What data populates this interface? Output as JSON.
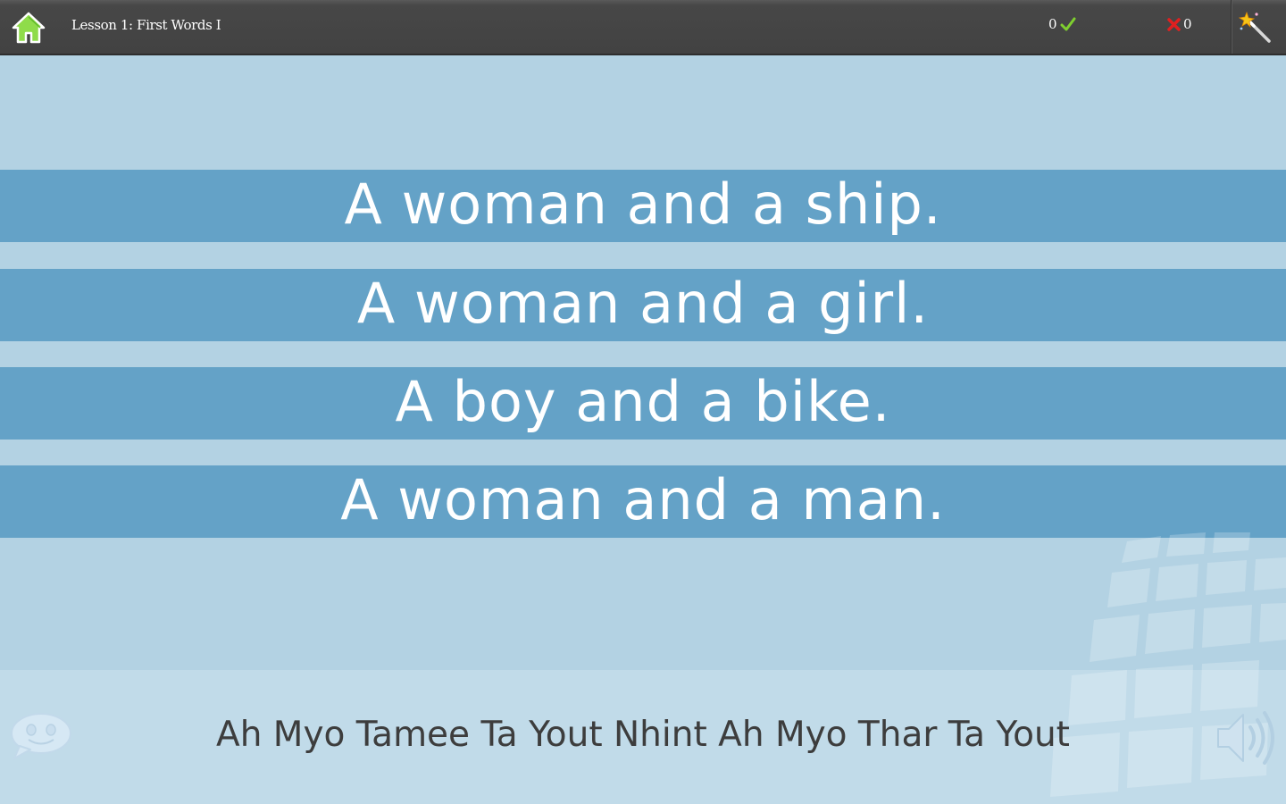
{
  "header": {
    "lesson_title": "Lesson 1: First Words I",
    "correct_count": "0",
    "wrong_count": "0",
    "home_icon": "home-icon",
    "correct_icon": "checkmark-icon",
    "wrong_icon": "cross-icon",
    "wand_icon": "magic-wand-icon"
  },
  "options": [
    {
      "label": "A woman and a ship."
    },
    {
      "label": "A woman and a girl."
    },
    {
      "label": "A boy and a bike."
    },
    {
      "label": "A woman and a man."
    }
  ],
  "prompt": {
    "phrase": "Ah Myo Tamee Ta Yout Nhint Ah Myo Thar Ta Yout",
    "hint_icon": "speech-bubble-face-icon",
    "sound_icon": "speaker-icon"
  },
  "colors": {
    "background": "#b3d2e3",
    "topbar": "#444444",
    "option_band": "#64a2c7",
    "bottom_panel": "#c1dbe9",
    "correct_green": "#7fcf2f",
    "wrong_red": "#e02020"
  }
}
